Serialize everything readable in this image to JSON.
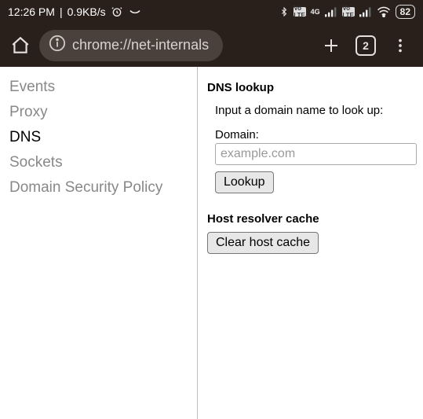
{
  "status": {
    "time": "12:26 PM",
    "netspeed": "0.9KB/s",
    "battery": "82"
  },
  "toolbar": {
    "url": "chrome://net-internals",
    "tab_count": "2"
  },
  "sidebar": {
    "items": [
      {
        "label": "Events"
      },
      {
        "label": "Proxy"
      },
      {
        "label": "DNS"
      },
      {
        "label": "Sockets"
      },
      {
        "label": "Domain Security Policy"
      }
    ],
    "active_index": 2
  },
  "dns": {
    "section_title": "DNS lookup",
    "instruction": "Input a domain name to look up:",
    "domain_label": "Domain:",
    "domain_placeholder": "example.com",
    "lookup_btn": "Lookup",
    "cache_section_title": "Host resolver cache",
    "clear_btn": "Clear host cache"
  }
}
